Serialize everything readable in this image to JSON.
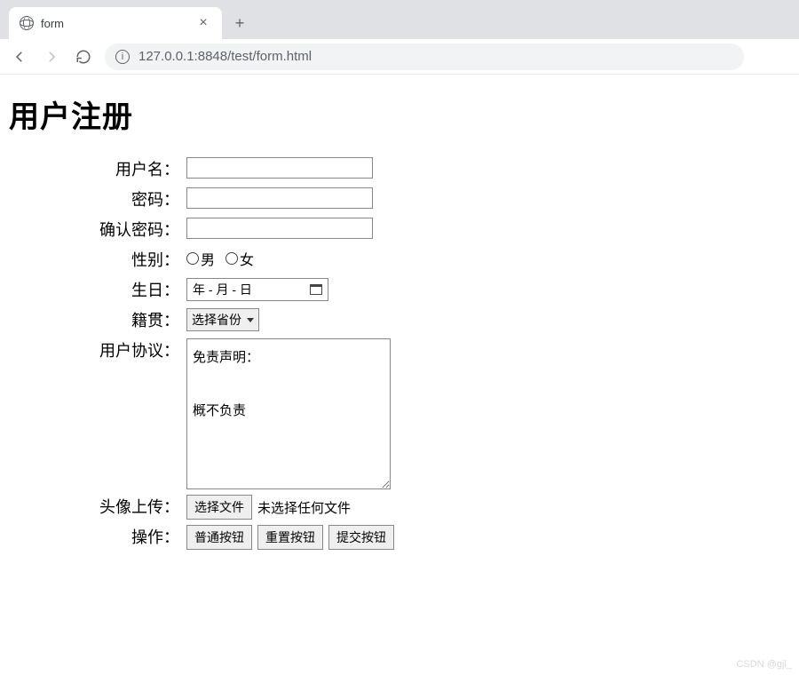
{
  "browser": {
    "tab_title": "form",
    "url": "127.0.0.1:8848/test/form.html"
  },
  "page": {
    "heading": "用户注册",
    "labels": {
      "username": "用户名：",
      "password": "密码：",
      "confirm": "确认密码：",
      "gender": "性别：",
      "birthday": "生日：",
      "origin": "籍贯：",
      "agreement": "用户协议：",
      "avatar": "头像上传：",
      "actions": "操作："
    },
    "gender": {
      "male": "男",
      "female": "女"
    },
    "date_placeholder": "年  - 月 - 日",
    "province_select": "选择省份",
    "agreement_text": "免责声明：\n\n概不负责",
    "file": {
      "button": "选择文件",
      "no_file": "未选择任何文件"
    },
    "buttons": {
      "normal": "普通按钮",
      "reset": "重置按钮",
      "submit": "提交按钮"
    }
  },
  "watermark": "CSDN @gjl_"
}
